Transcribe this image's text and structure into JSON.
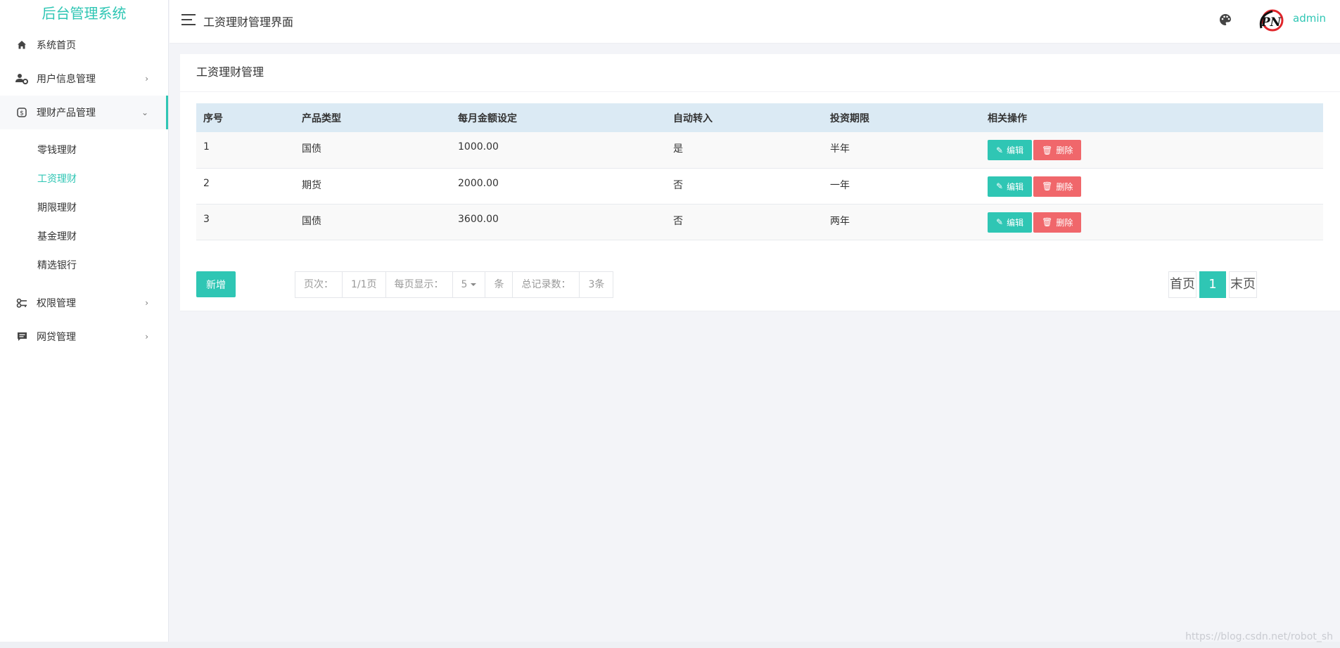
{
  "sidebar": {
    "brand": "后台管理系统",
    "items": [
      {
        "label": "系统首页",
        "icon": "home-icon"
      },
      {
        "label": "用户信息管理",
        "icon": "user-settings-icon"
      },
      {
        "label": "理财产品管理",
        "icon": "money-icon"
      },
      {
        "label": "权限管理",
        "icon": "key-icon"
      },
      {
        "label": "网贷管理",
        "icon": "message-icon"
      }
    ],
    "submenu": [
      "零钱理财",
      "工资理财",
      "期限理财",
      "基金理财",
      "精选银行"
    ],
    "active_submenu": "工资理财"
  },
  "header": {
    "title": "工资理财管理界面",
    "username": "admin",
    "avatar_text": "PN"
  },
  "card": {
    "title": "工资理财管理"
  },
  "table": {
    "columns": [
      "序号",
      "产品类型",
      "每月金额设定",
      "自动转入",
      "投资期限",
      "相关操作"
    ],
    "rows": [
      {
        "id": "1",
        "type": "国债",
        "amount": "1000.00",
        "auto": "是",
        "term": "半年"
      },
      {
        "id": "2",
        "type": "期货",
        "amount": "2000.00",
        "auto": "否",
        "term": "一年"
      },
      {
        "id": "3",
        "type": "国债",
        "amount": "3600.00",
        "auto": "否",
        "term": "两年"
      }
    ],
    "edit_label": "编辑",
    "delete_label": "删除"
  },
  "footer": {
    "add_label": "新增",
    "page_label": "页次：",
    "page_value": "1/1页",
    "per_page_label": "每页显示：",
    "per_page_value": "5",
    "per_page_unit": "条",
    "total_label": "总记录数：",
    "total_value": "3条",
    "first_label": "首页",
    "current_page": "1",
    "last_label": "末页"
  },
  "watermark": "https://blog.csdn.net/robot_sh",
  "colors": {
    "accent": "#2fc6b4",
    "danger": "#f0676b",
    "table_header": "#dbeaf4"
  }
}
